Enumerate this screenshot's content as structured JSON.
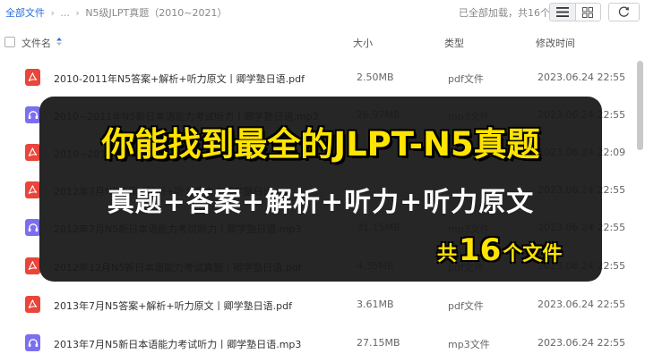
{
  "breadcrumb": {
    "root": "全部文件",
    "sep1": "›",
    "ellipsis": "...",
    "sep2": "›",
    "current": "N5级JLPT真题（2010~2021）"
  },
  "status_text": "已全部加载，共16个",
  "columns": {
    "name": "文件名",
    "size": "大小",
    "type": "类型",
    "modified": "修改时间"
  },
  "files": [
    {
      "name": "2010-2011年N5答案+解析+听力原文丨卿学塾日语.pdf",
      "size": "2.50MB",
      "type": "pdf文件",
      "time": "2023.06.24 22:55",
      "icon": "pdf"
    },
    {
      "name": "2010~2011年N5新日本语能力考试听力丨卿学塾日语.mp3",
      "size": "26.97MB",
      "type": "mp3文件",
      "time": "2023.06.24 22:55",
      "icon": "mp3"
    },
    {
      "name": "2010~2011年N5新日本语能力考试真题丨卿学塾日语.pdf",
      "size": "",
      "type": "",
      "time": "2023.06.24 22:09",
      "icon": "pdf"
    },
    {
      "name": "2012年7月N5答案+解析+听力原文丨卿学塾日语.pdf",
      "size": "",
      "type": "",
      "time": "2023.06.24 22:55",
      "icon": "pdf"
    },
    {
      "name": "2012年7月N5新日本语能力考试听力丨卿学塾日语.mp3",
      "size": "31.15MB",
      "type": "mp3文件",
      "time": "2023.06.24 22:55",
      "icon": "mp3"
    },
    {
      "name": "2012年12月N5新日本语能力考试真题丨卿学塾日语.pdf",
      "size": "4.35MB",
      "type": "pdf文件",
      "time": "2023.06.24 22:55",
      "icon": "pdf"
    },
    {
      "name": "2013年7月N5答案+解析+听力原文丨卿学塾日语.pdf",
      "size": "3.61MB",
      "type": "pdf文件",
      "time": "2023.06.24 22:55",
      "icon": "pdf"
    },
    {
      "name": "2013年7月N5新日本语能力考试听力丨卿学塾日语.mp3",
      "size": "27.15MB",
      "type": "mp3文件",
      "time": "2023.06.24 22:55",
      "icon": "mp3"
    }
  ],
  "banner": {
    "title": "你能找到最全的JLPT-N5真题",
    "subtitle": "真题+答案+解析+听力+听力原文",
    "count_prefix": "共",
    "count_number": "16",
    "count_suffix": "个文件"
  },
  "colors": {
    "pdf_icon": "#e9453b",
    "mp3_icon": "#7b6ff0",
    "link": "#2a6fdb",
    "highlight": "#ffe400"
  }
}
